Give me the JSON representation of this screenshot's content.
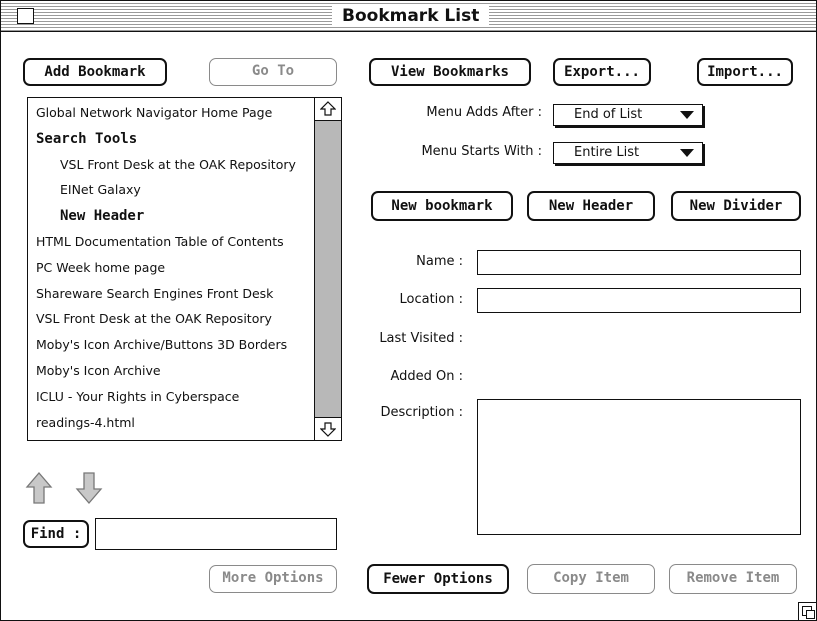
{
  "window": {
    "title": "Bookmark List"
  },
  "toolbar": {
    "add_bookmark": "Add Bookmark",
    "go_to": "Go To",
    "view_bookmarks": "View Bookmarks",
    "export": "Export...",
    "import": "Import..."
  },
  "bookmarks": {
    "items": [
      {
        "label": "Global Network Navigator Home Page",
        "indent": false,
        "header": false
      },
      {
        "label": "Search Tools",
        "indent": false,
        "header": true
      },
      {
        "label": "VSL Front Desk at the OAK Repository",
        "indent": true,
        "header": false
      },
      {
        "label": "EINet Galaxy",
        "indent": true,
        "header": false
      },
      {
        "label": "New Header",
        "indent": true,
        "header": true
      },
      {
        "label": "HTML Documentation Table of Contents",
        "indent": false,
        "header": false
      },
      {
        "label": "PC Week home page",
        "indent": false,
        "header": false
      },
      {
        "label": "Shareware Search Engines Front Desk",
        "indent": false,
        "header": false
      },
      {
        "label": "VSL Front Desk at the OAK Repository",
        "indent": false,
        "header": false
      },
      {
        "label": "Moby's Icon Archive/Buttons 3D Borders",
        "indent": false,
        "header": false
      },
      {
        "label": "Moby's Icon Archive",
        "indent": false,
        "header": false
      },
      {
        "label": "ICLU - Your Rights in Cyberspace",
        "indent": false,
        "header": false
      },
      {
        "label": "readings-4.html",
        "indent": false,
        "header": false
      }
    ]
  },
  "menu": {
    "adds_after_label": "Menu Adds After :",
    "adds_after_value": "End of List",
    "starts_with_label": "Menu Starts With :",
    "starts_with_value": "Entire List"
  },
  "actions": {
    "new_bookmark": "New bookmark",
    "new_header": "New Header",
    "new_divider": "New Divider"
  },
  "details": {
    "name_label": "Name :",
    "name_value": "",
    "location_label": "Location :",
    "location_value": "",
    "last_visited_label": "Last Visited :",
    "added_on_label": "Added On :",
    "description_label": "Description :",
    "description_value": ""
  },
  "find": {
    "label": "Find :",
    "value": ""
  },
  "bottom": {
    "more_options": "More Options",
    "fewer_options": "Fewer Options",
    "copy_item": "Copy Item",
    "remove_item": "Remove Item"
  },
  "icons": {
    "move_up": "up-arrow-icon",
    "move_down": "down-arrow-icon",
    "scroll_up": "scroll-up-icon",
    "scroll_down": "scroll-down-icon"
  }
}
